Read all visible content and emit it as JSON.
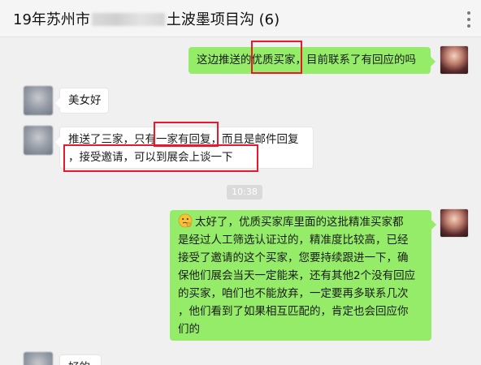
{
  "header": {
    "title_prefix": "19年苏州市",
    "title_suffix": "土波墨项目沟 (6)"
  },
  "messages": [
    {
      "direction": "out",
      "lines": [
        "这边推送的优质买家，目前联系了有回应的吗"
      ]
    },
    {
      "direction": "in",
      "lines": [
        "美女好"
      ]
    },
    {
      "direction": "in",
      "lines": [
        "推送了三家，只有一家有回复，而且是邮件回复",
        "，接受邀请，可以到展会上谈一下"
      ]
    },
    {
      "direction": "out",
      "emoji": "thinking-face",
      "lines": [
        "太好了，优质买家库里面的这批精准买家都",
        "是经过人工筛选认证过的，精准度比较高，已经",
        "接受了邀请的这个买家，您要持续跟进一下，确",
        "保他们展会当天一定能来，还有其他2个没有回应",
        "的买家，咱们也不能放弃，一定要再多联系几次",
        "，他们看到了如果相互匹配的，肯定也会回应你",
        "们的"
      ]
    },
    {
      "direction": "in",
      "lines": [
        "好的"
      ]
    }
  ],
  "timestamp": "10:38",
  "colors": {
    "bubble_out": "#95ec69",
    "bubble_in": "#ffffff",
    "highlight": "#e8192c",
    "background": "#f0f0f0"
  }
}
